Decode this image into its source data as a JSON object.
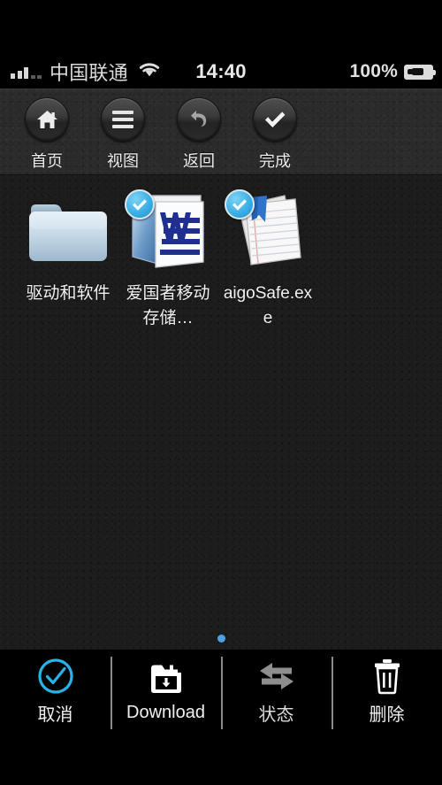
{
  "status_bar": {
    "carrier": "中国联通",
    "time": "14:40",
    "battery_percent": "100%",
    "signal_icon": "signal-bars-icon",
    "wifi_icon": "wifi-icon",
    "battery_icon": "battery-charging-icon"
  },
  "toolbar": {
    "buttons": [
      {
        "label": "首页",
        "icon": "home-icon",
        "state": "enabled"
      },
      {
        "label": "视图",
        "icon": "list-view-icon",
        "state": "enabled"
      },
      {
        "label": "返回",
        "icon": "undo-back-icon",
        "state": "dim"
      },
      {
        "label": "完成",
        "icon": "check-done-icon",
        "state": "enabled"
      }
    ]
  },
  "files": [
    {
      "label": "驱动和软件",
      "icon": "folder-icon",
      "selected": false
    },
    {
      "label": "爱国者移动存储…",
      "icon": "word-document-icon",
      "selected": true
    },
    {
      "label": "aigoSafe.exe",
      "icon": "text-document-icon",
      "selected": true
    }
  ],
  "pagination": {
    "dots": 1,
    "active_index": 0
  },
  "bottom_bar": {
    "buttons": [
      {
        "label": "取消",
        "icon": "circle-check-icon",
        "state": "active"
      },
      {
        "label": "Download",
        "icon": "folder-download-icon",
        "state": "enabled"
      },
      {
        "label": "状态",
        "icon": "transfer-arrows-icon",
        "state": "disabled"
      },
      {
        "label": "删除",
        "icon": "trash-icon",
        "state": "enabled"
      }
    ]
  },
  "colors": {
    "accent_blue": "#3bb0e6",
    "cancel_cyan": "#26b3e8",
    "background_dark": "#1c1c1c",
    "toolbar_dark": "#2b2b2b",
    "bar_black": "#000000",
    "text_white": "#f2f2f2",
    "disabled_gray": "#8a8a8a"
  }
}
